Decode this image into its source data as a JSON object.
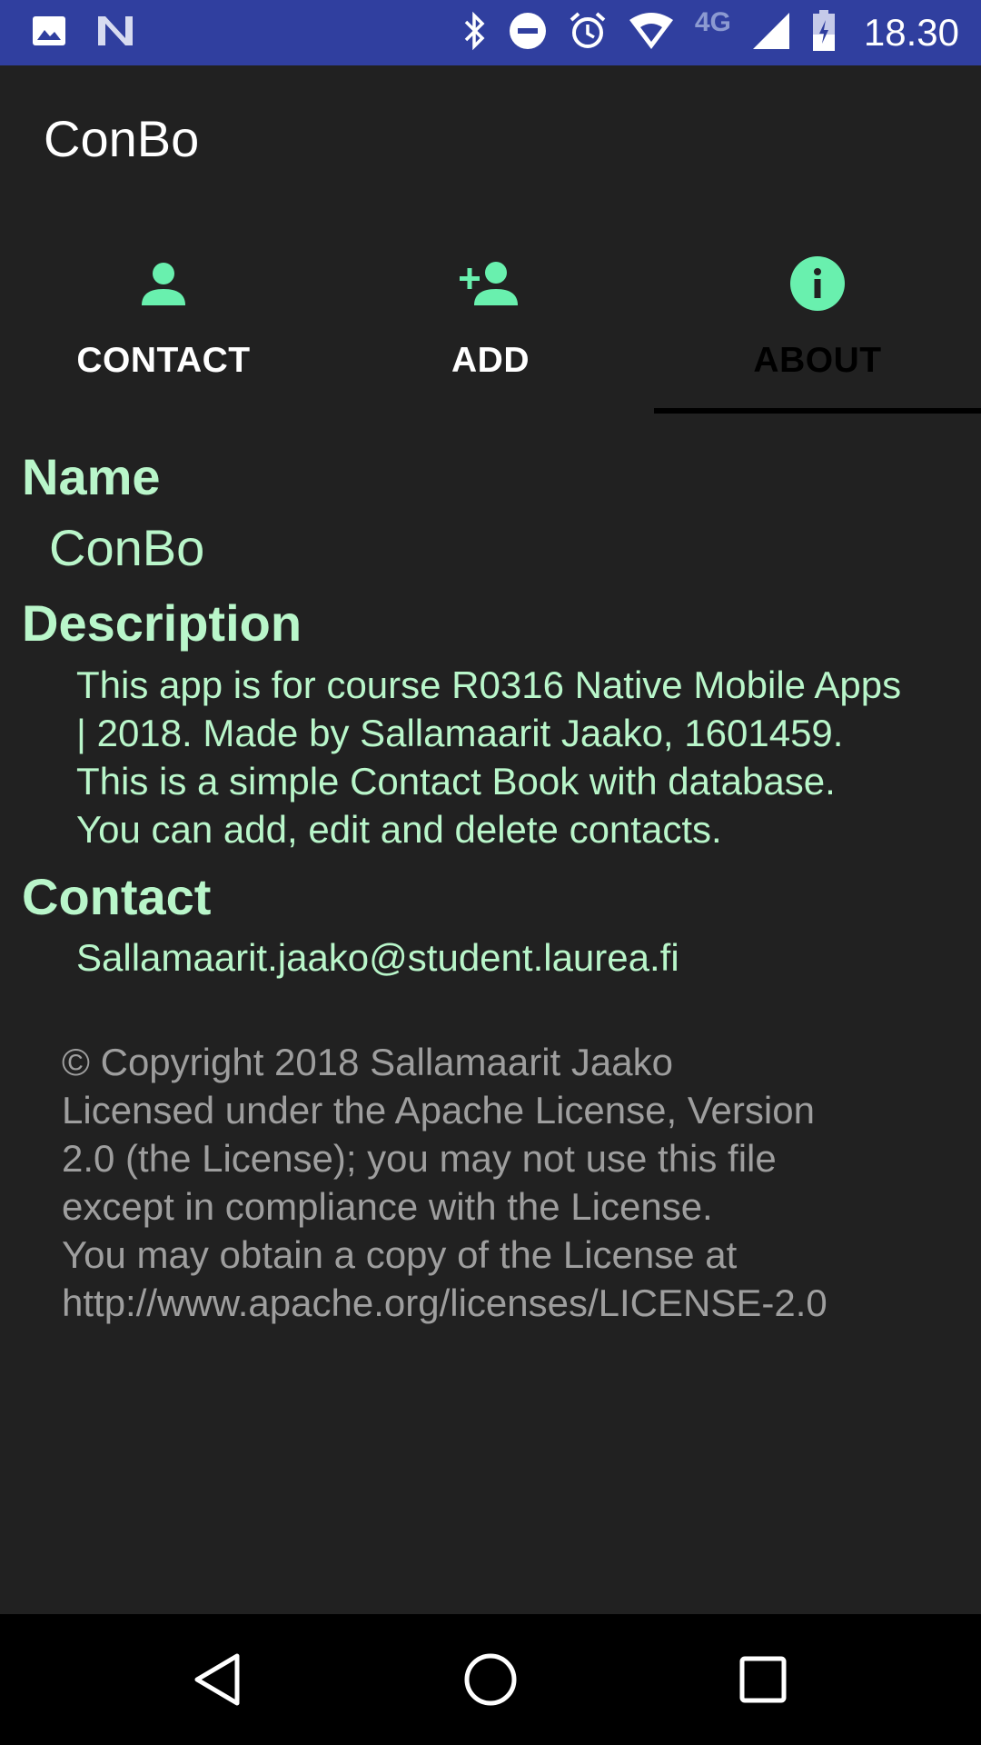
{
  "status_bar": {
    "network": "4G",
    "time": "18.30",
    "icons": [
      "image-icon",
      "n-notification-icon",
      "bluetooth-icon",
      "do-not-disturb-icon",
      "alarm-icon",
      "wifi-icon",
      "signal-icon",
      "battery-icon"
    ],
    "background": "#303f9f"
  },
  "app": {
    "title": "ConBo"
  },
  "tabs": [
    {
      "label": "CONTACT",
      "icon": "person-icon",
      "active": false
    },
    {
      "label": "ADD",
      "icon": "add-person-icon",
      "active": false
    },
    {
      "label": "ABOUT",
      "icon": "info-icon",
      "active": true
    }
  ],
  "about": {
    "name_heading": "Name",
    "name_value": "ConBo",
    "description_heading": "Description",
    "description_lines": [
      "This app is for course R0316 Native Mobile Apps",
      "| 2018. Made by Sallamaarit Jaako, 1601459.",
      "This is a simple Contact Book with database.",
      "You can add, edit and delete contacts."
    ],
    "contact_heading": "Contact",
    "contact_email": "Sallamaarit.jaako@student.laurea.fi",
    "license_lines": [
      "© Copyright 2018 Sallamaarit Jaako",
      "Licensed under the Apache License, Version",
      "2.0 (the License); you may not use this file",
      "except in compliance with the License.",
      "You may obtain a copy of the License at",
      "http://www.apache.org/licenses/LICENSE-2.0"
    ]
  },
  "colors": {
    "accent": "#69f0ae",
    "text_accent": "#b9f6ca",
    "background": "#212121",
    "license_text": "#9e9e9e"
  },
  "nav_bar": {
    "buttons": [
      "back-icon",
      "home-icon",
      "recents-icon"
    ]
  }
}
